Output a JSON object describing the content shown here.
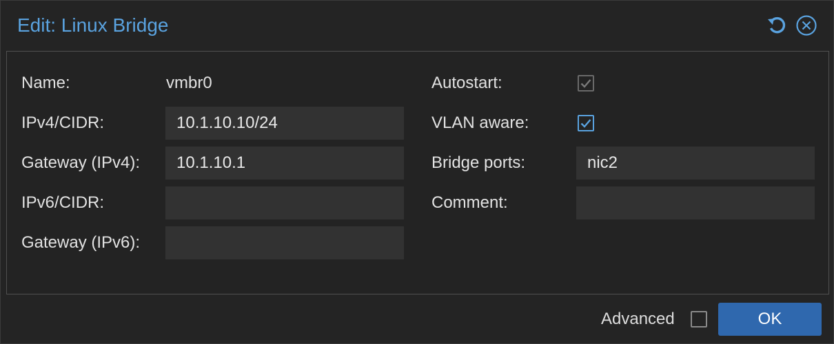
{
  "dialog": {
    "title": "Edit: Linux Bridge",
    "tools": {
      "reset_icon": "reset-icon",
      "close_icon": "close-circle-icon"
    }
  },
  "left": {
    "name_label": "Name:",
    "name_value": "vmbr0",
    "ipv4_label": "IPv4/CIDR:",
    "ipv4_value": "10.1.10.10/24",
    "gw4_label": "Gateway (IPv4):",
    "gw4_value": "10.1.10.1",
    "ipv6_label": "IPv6/CIDR:",
    "ipv6_value": "",
    "gw6_label": "Gateway (IPv6):",
    "gw6_value": ""
  },
  "right": {
    "autostart_label": "Autostart:",
    "autostart_checked": true,
    "vlan_label": "VLAN aware:",
    "vlan_checked": true,
    "ports_label": "Bridge ports:",
    "ports_value": "nic2",
    "comment_label": "Comment:",
    "comment_value": ""
  },
  "footer": {
    "advanced_label": "Advanced",
    "advanced_checked": false,
    "ok_label": "OK"
  },
  "colors": {
    "accent": "#5aa3e0",
    "ok_button": "#2f68ae",
    "background": "#242424",
    "field": "#323232"
  }
}
